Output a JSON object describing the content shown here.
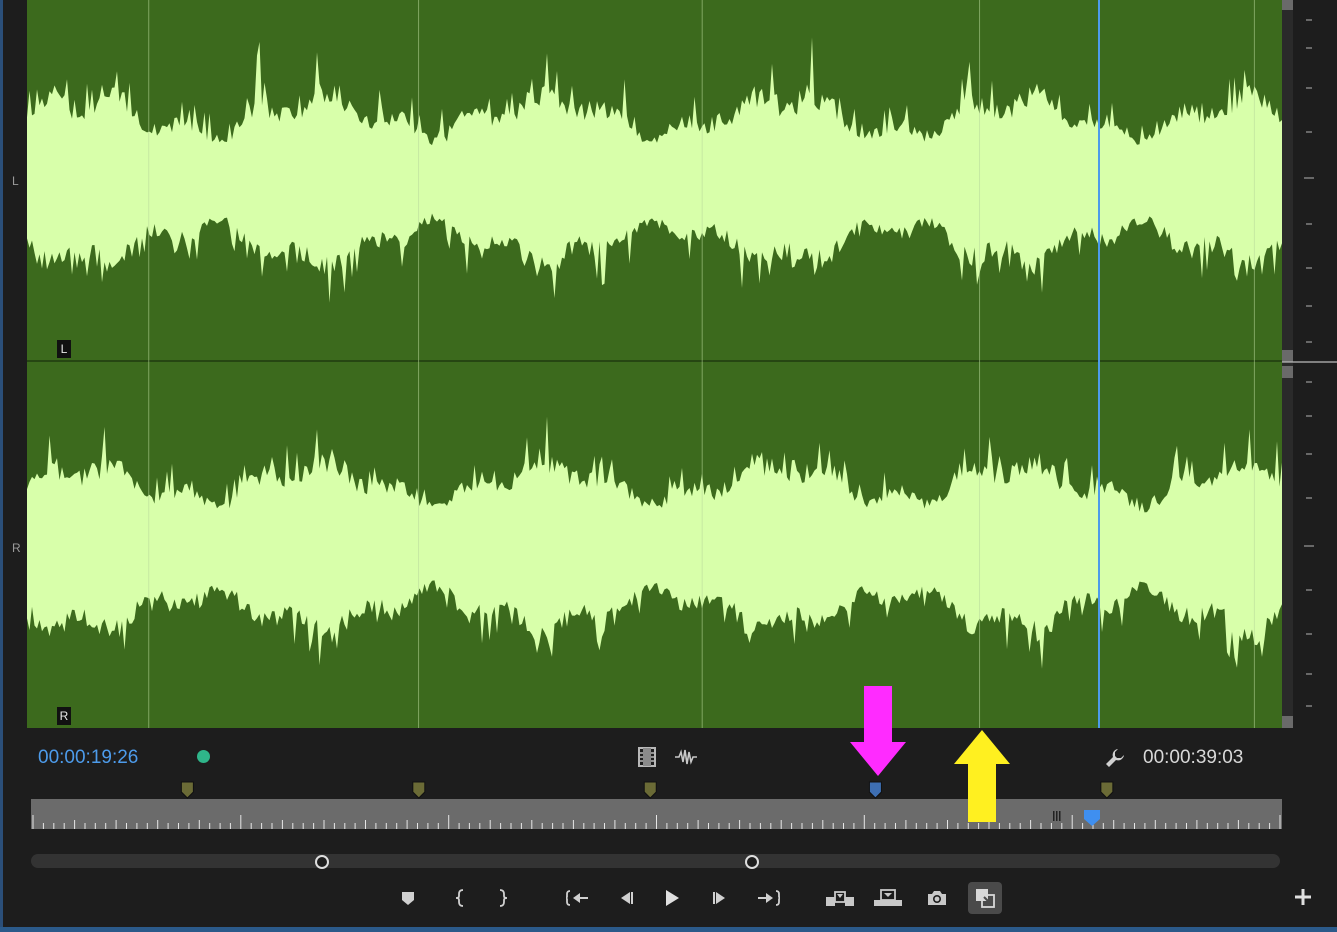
{
  "channels": {
    "left_side_label": "L",
    "right_side_label": "R",
    "left_badge": "L",
    "right_badge": "R"
  },
  "timecodes": {
    "current": "00:00:19:26",
    "duration": "00:00:39:03"
  },
  "colors": {
    "waveform_bg": "#3c6a1d",
    "waveform_fg": "#d8ffaa",
    "playhead": "#4d9bea",
    "timecode_current": "#4d9bea",
    "status_dot": "#2fb58a",
    "marker_default": "#6b6b36",
    "marker_selected": "#3e6fb3",
    "annotation_magenta": "#ff2bff",
    "annotation_yellow": "#fff020"
  },
  "icons": {
    "settings": "wrench-icon",
    "drag_video": "film-strip-icon",
    "drag_audio": "audio-waveform-icon",
    "add": "plus-icon"
  },
  "markers": {
    "timeline_positions": [
      0.125,
      0.31,
      0.495,
      0.675,
      0.86
    ],
    "selected_index": 3
  },
  "controls": [
    {
      "name": "add-marker-button",
      "icon": "marker-icon"
    },
    {
      "name": "mark-in-button",
      "icon": "mark-in-icon"
    },
    {
      "name": "mark-out-button",
      "icon": "mark-out-icon"
    },
    {
      "name": "go-to-in-button",
      "icon": "go-to-in-icon"
    },
    {
      "name": "step-back-button",
      "icon": "step-back-icon"
    },
    {
      "name": "play-button",
      "icon": "play-icon"
    },
    {
      "name": "step-forward-button",
      "icon": "step-forward-icon"
    },
    {
      "name": "go-to-out-button",
      "icon": "go-to-out-icon"
    },
    {
      "name": "insert-button",
      "icon": "insert-icon"
    },
    {
      "name": "overwrite-button",
      "icon": "overwrite-icon"
    },
    {
      "name": "export-frame-button",
      "icon": "camera-icon"
    },
    {
      "name": "toggle-proxies-button",
      "icon": "toggle-proxies-icon"
    }
  ]
}
